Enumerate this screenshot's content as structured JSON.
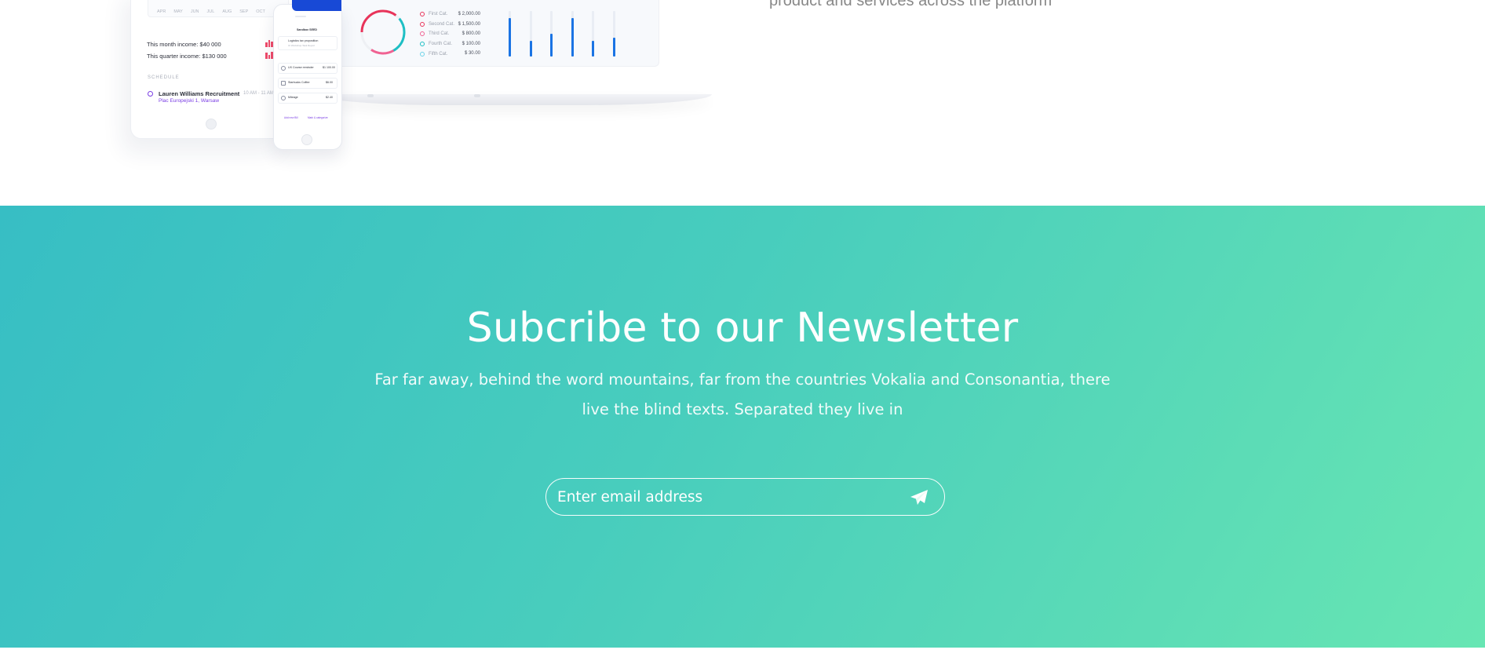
{
  "top_section": {
    "cut_text": "product and services across the platform",
    "tablet": {
      "months": [
        "APR",
        "MAY",
        "JUN",
        "JUL",
        "AUG",
        "SEP",
        "OCT"
      ],
      "month_income": "This month income: $40 000",
      "quarter_income": "This quarter income: $130 000",
      "schedule_title": "SCHEDULE",
      "schedule_name": "Lauren Williams Recruitment",
      "schedule_place": "Plac Europejski 1, Warsaw",
      "schedule_time": "10 AM - 11 AM"
    },
    "laptop": {
      "legend": [
        {
          "label": "First Cat.",
          "value": "$ 2,000.00",
          "color": "#e8345a"
        },
        {
          "label": "Second Cat.",
          "value": "$ 1,500.00",
          "color": "#e8345a"
        },
        {
          "label": "Third Cat.",
          "value": "$ 800.00",
          "color": "#f06292"
        },
        {
          "label": "Fourth Cat.",
          "value": "$ 100.00",
          "color": "#1ebfc4"
        },
        {
          "label": "Fifth Cat.",
          "value": "$ 30.00",
          "color": "#6dd3e8"
        }
      ],
      "bar_levels": [
        0.85,
        0.35,
        0.5,
        0.85,
        0.35,
        0.42
      ]
    },
    "phone": {
      "header": "Sandbox SEED",
      "card1_title": "Logistics tax proposition",
      "card1_sub": "UI Workshop Task Report",
      "row1_title": "UX Course reminder",
      "row1_value": "$1 100.00",
      "row2_title": "Starbucks Coffee",
      "row2_value": "$6.00",
      "row3_title": "Mileage",
      "row3_value": "$2.40",
      "action_left": "Add new Bill",
      "action_right": "Mark & categorize"
    }
  },
  "newsletter": {
    "title": "Subcribe to our Newsletter",
    "description": "Far far away, behind the word mountains, far from the countries Vokalia and Consonantia, there live the blind texts. Separated they live in",
    "email_placeholder": "Enter email address",
    "send_icon": "paper-plane-icon"
  },
  "colors": {
    "gradient_start": "#37bec4",
    "gradient_end": "#67e6b3",
    "chart_blue": "#1b74e4",
    "accent_purple": "#7b3fe4",
    "accent_red": "#f04b6a"
  }
}
